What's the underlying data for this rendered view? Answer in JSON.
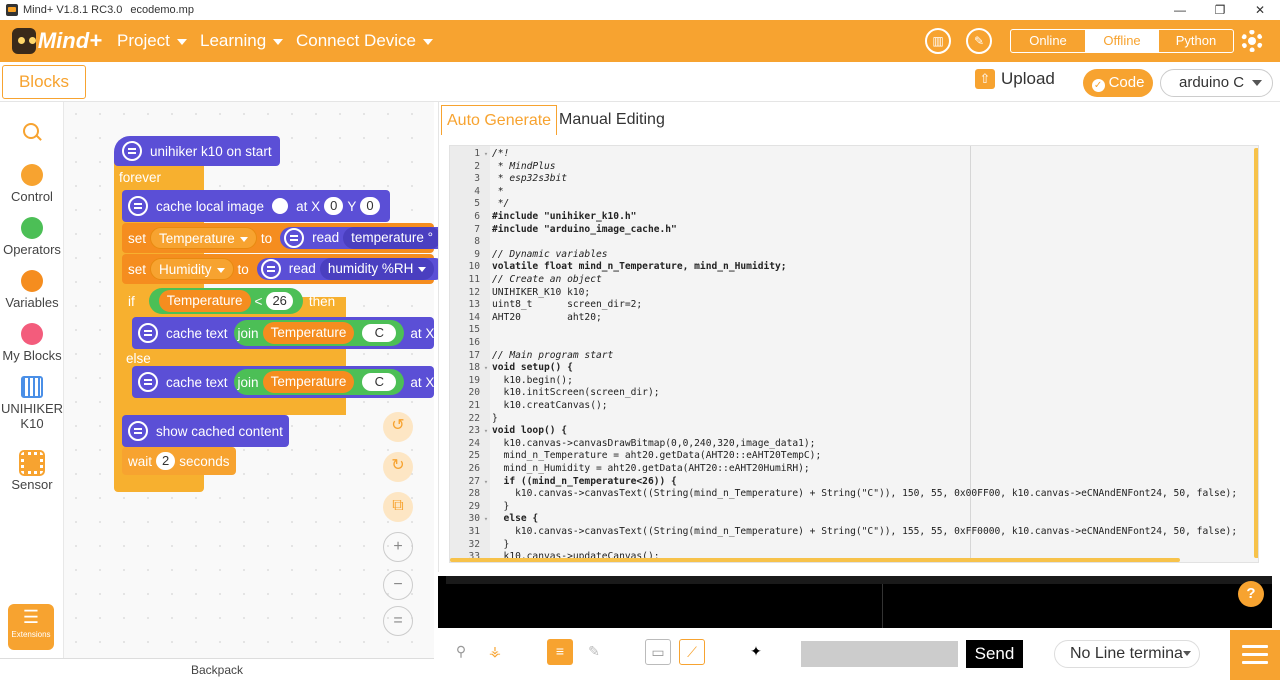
{
  "window": {
    "title": "Mind+ V1.8.1 RC3.0",
    "file": "ecodemo.mp",
    "minimize": "—",
    "maximize": "❐",
    "close": "✕"
  },
  "menu": {
    "logo": "Mind+",
    "project": "Project",
    "learning": "Learning",
    "connect": "Connect Device"
  },
  "modes": {
    "online": "Online",
    "offline": "Offline",
    "python": "Python",
    "selected": "Offline"
  },
  "toolbar": {
    "blocks_tab": "Blocks",
    "upload": "Upload",
    "code": "Code",
    "board": "arduino C"
  },
  "categories": [
    {
      "label": "Control",
      "color": "#f7a330"
    },
    {
      "label": "Operators",
      "color": "#4cbf56"
    },
    {
      "label": "Variables",
      "color": "#f58d1f"
    },
    {
      "label": "My Blocks",
      "color": "#f35c7c"
    },
    {
      "label": "UNIHIKER K10",
      "color": "#4a8fe7"
    },
    {
      "label": "Sensor",
      "color": "#f7a330"
    }
  ],
  "extensions_label": "Extensions",
  "backpack_label": "Backpack",
  "blocks": {
    "hat": "unihiker k10 on start",
    "forever": "forever",
    "cache_image": {
      "label": "cache local image",
      "at_x": "at X",
      "x": "0",
      "y_label": "Y",
      "y": "0"
    },
    "set1": {
      "set": "set",
      "var": "Temperature",
      "to": "to",
      "read": "read",
      "sensor": "temperature °"
    },
    "set2": {
      "set": "set",
      "var": "Humidity",
      "to": "to",
      "read": "read",
      "sensor": "humidity %RH"
    },
    "if": {
      "if": "if",
      "var": "Temperature",
      "op": "<",
      "value": "26",
      "then": "then"
    },
    "cache_text1": {
      "label": "cache text",
      "join": "join",
      "var": "Temperature",
      "str": "C",
      "at": "at X:"
    },
    "else": "else",
    "cache_text2": {
      "label": "cache text",
      "join": "join",
      "var": "Temperature",
      "str": "C",
      "at": "at X:"
    },
    "show": "show cached content",
    "wait": {
      "wait": "wait",
      "value": "2",
      "unit": "seconds"
    }
  },
  "code_tabs": {
    "auto": "Auto Generate",
    "manual": "Manual Editing"
  },
  "code_lines": [
    "/*!",
    " * MindPlus",
    " * esp32s3bit",
    " *",
    " */",
    "#include \"unihiker_k10.h\"",
    "#include \"arduino_image_cache.h\"",
    "",
    "// Dynamic variables",
    "volatile float mind_n_Temperature, mind_n_Humidity;",
    "// Create an object",
    "UNIHIKER_K10 k10;",
    "uint8_t      screen_dir=2;",
    "AHT20        aht20;",
    "",
    "",
    "// Main program start",
    "void setup() {",
    "  k10.begin();",
    "  k10.initScreen(screen_dir);",
    "  k10.creatCanvas();",
    "}",
    "void loop() {",
    "  k10.canvas->canvasDrawBitmap(0,0,240,320,image_data1);",
    "  mind_n_Temperature = aht20.getData(AHT20::eAHT20TempC);",
    "  mind_n_Humidity = aht20.getData(AHT20::eAHT20HumiRH);",
    "  if ((mind_n_Temperature<26)) {",
    "    k10.canvas->canvasText((String(mind_n_Temperature) + String(\"C\")), 150, 55, 0x00FF00, k10.canvas->eCNAndENFont24, 50, false);",
    "  }",
    "  else {",
    "    k10.canvas->canvasText((String(mind_n_Temperature) + String(\"C\")), 155, 55, 0xFF0000, k10.canvas->eCNAndENFont24, 50, false);",
    "  }",
    "  k10.canvas->updateCanvas();"
  ],
  "serial": {
    "send": "Send",
    "line_ending": "No Line termina",
    "help": "?"
  }
}
